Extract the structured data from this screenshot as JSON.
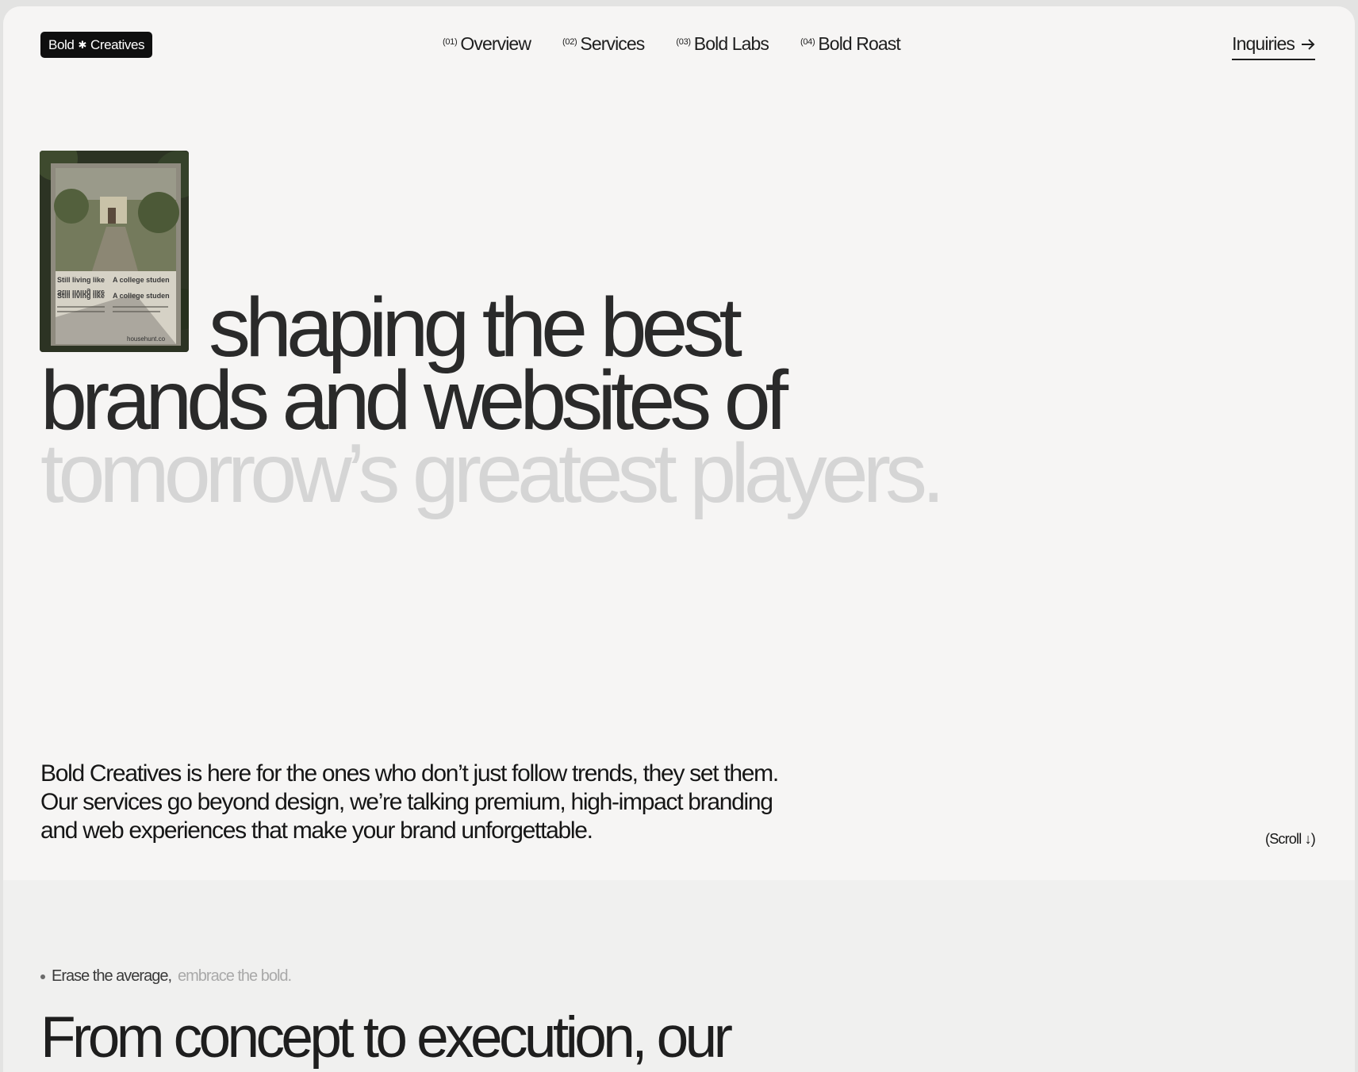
{
  "header": {
    "logo": {
      "left": "Bold",
      "right": "Creatives",
      "icon": "bolt-icon"
    },
    "nav": [
      {
        "num": "(01)",
        "label": "Overview"
      },
      {
        "num": "(02)",
        "label": "Services"
      },
      {
        "num": "(03)",
        "label": "Bold Labs"
      },
      {
        "num": "(04)",
        "label": "Bold Roast"
      }
    ],
    "cta": {
      "label": "Inquiries",
      "icon": "arrow-right-icon"
    }
  },
  "hero": {
    "image": {
      "poster_lines": [
        "Still living like",
        "A college student",
        "househunt.co"
      ]
    },
    "line1": "shaping the best",
    "line2": "brands and websites of",
    "line3": "tomorrow’s greatest players."
  },
  "intro": {
    "text": "Bold Creatives is here for the ones who don’t just follow trends, they set them. Our services go beyond design, we’re talking premium, high-impact branding and web experiences that make your brand unforgettable.",
    "scroll": "(Scroll ↓)"
  },
  "section2": {
    "tagline_dark": "Erase the average,",
    "tagline_light": "embrace the bold.",
    "heading": "From concept to execution, our"
  },
  "colors": {
    "background": "#f6f5f4",
    "text": "#1e1e1e",
    "muted_headline": "#d5d5d5",
    "logo_bg": "#0f0f0f"
  }
}
